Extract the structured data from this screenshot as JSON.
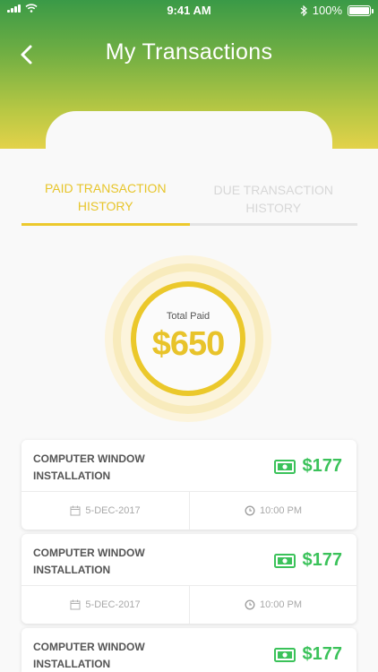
{
  "status_bar": {
    "time": "9:41 AM",
    "battery": "100%"
  },
  "header": {
    "title": "My Transactions",
    "back_icon": "chevron-left-icon"
  },
  "tabs": [
    {
      "label": "PAID TRANSACTION HISTORY",
      "active": true
    },
    {
      "label": "DUE TRANSACTION HISTORY",
      "active": false
    }
  ],
  "summary": {
    "label": "Total Paid",
    "amount": "$650"
  },
  "colors": {
    "accent": "#ebc82b",
    "amount_green": "#3bc25a",
    "header_top": "#3a9a47",
    "header_bottom": "#e3d24a"
  },
  "transactions": [
    {
      "title": "COMPUTER WINDOW INSTALLATION",
      "amount": "$177",
      "date": "5-DEC-2017",
      "time": "10:00 PM"
    },
    {
      "title": "COMPUTER WINDOW INSTALLATION",
      "amount": "$177",
      "date": "5-DEC-2017",
      "time": "10:00 PM"
    },
    {
      "title": "COMPUTER WINDOW INSTALLATION",
      "amount": "$177",
      "date": "",
      "time": ""
    }
  ]
}
